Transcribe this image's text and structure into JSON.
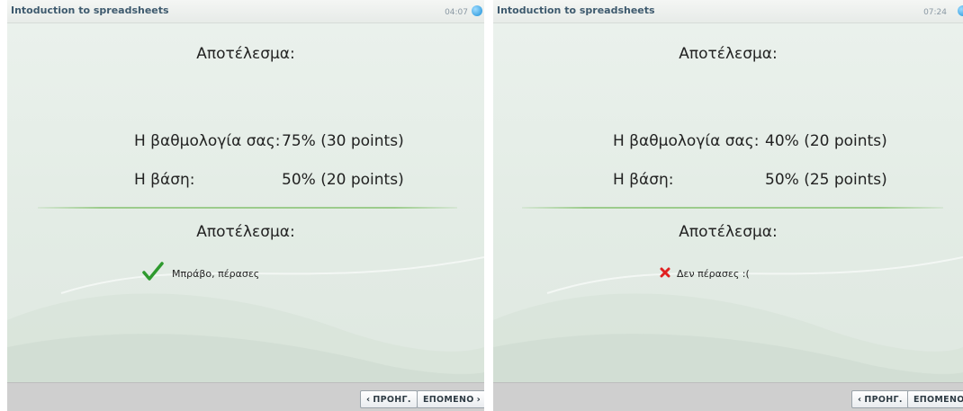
{
  "panels": [
    {
      "course_title": "Intoduction to spreadsheets",
      "timer": "04:07",
      "result_heading": "Αποτέλεσμα:",
      "score_label": "Η βαθμολογία σας:",
      "score_value": "75% (30 points)",
      "pass_label": "Η βάση:",
      "pass_value": "50% (20 points)",
      "outcome_heading": "Αποτέλεσμα:",
      "outcome_text": "Μπράβο, πέρασες",
      "outcome_icon": "checkmark-icon",
      "prev_label": "ΠΡΟΗΓ.",
      "next_label": "ΕΠΟΜΕΝΟ"
    },
    {
      "course_title": "Intoduction to spreadsheets",
      "timer": "07:24",
      "result_heading": "Αποτέλεσμα:",
      "score_label": "Η βαθμολογία σας:",
      "score_value": "40% (20 points)",
      "pass_label": "Η βάση:",
      "pass_value": "50% (25 points)",
      "outcome_heading": "Αποτέλεσμα:",
      "outcome_text": "Δεν πέρασες :(",
      "outcome_icon": "cross-icon",
      "prev_label": "ΠΡΟΗΓ.",
      "next_label": "ΕΠΟΜΕΝΟ"
    }
  ],
  "colors": {
    "title": "#3e5a6e",
    "pass_icon": "#2e9a2e",
    "fail_icon": "#e02020",
    "divider": "#9ccc8c",
    "footer": "#cfcfcf"
  }
}
